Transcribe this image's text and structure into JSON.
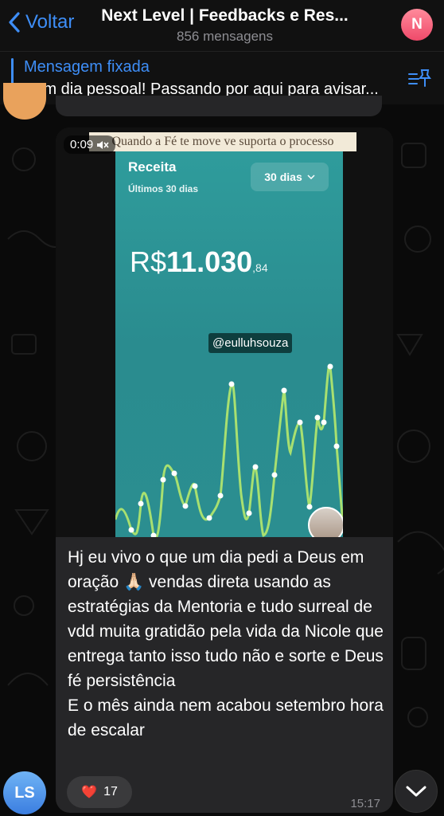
{
  "header": {
    "back_label": "Voltar",
    "title": "Next Level | Feedbacks e Res...",
    "subtitle": "856 mensagens",
    "avatar_initial": "N"
  },
  "pinned": {
    "title": "Mensagem fixada",
    "text": "Bom dia pessoal! Passando por aqui para avisar..."
  },
  "message": {
    "video": {
      "duration": "0:09",
      "caption": "Quando a Fé te move ve suporta o processo",
      "screen": {
        "title": "Receita",
        "subtitle": "Últimos 30 dias",
        "period": "30 dias",
        "currency": "R$",
        "amount": "11.030",
        "cents": ",84",
        "handle": "@eulluhsouza"
      }
    },
    "text": "Hj eu vivo o que um dia pedi a Deus em oração 🙏🏻 vendas direta usando as estratégias da Mentoria e tudo surreal de vdd muita gratidão pela vida da Nicole que entrega tanto isso tudo não e sorte e Deus fé persistência\nE o mês ainda nem acabou setembro hora de escalar",
    "reaction": {
      "emoji": "❤️",
      "count": "17"
    },
    "time": "15:17"
  },
  "sender_avatar": "LS",
  "colors": {
    "accent": "#3e8ef7",
    "bubble": "#262628",
    "screen": "#2f9c9c",
    "line": "#a8e070"
  }
}
